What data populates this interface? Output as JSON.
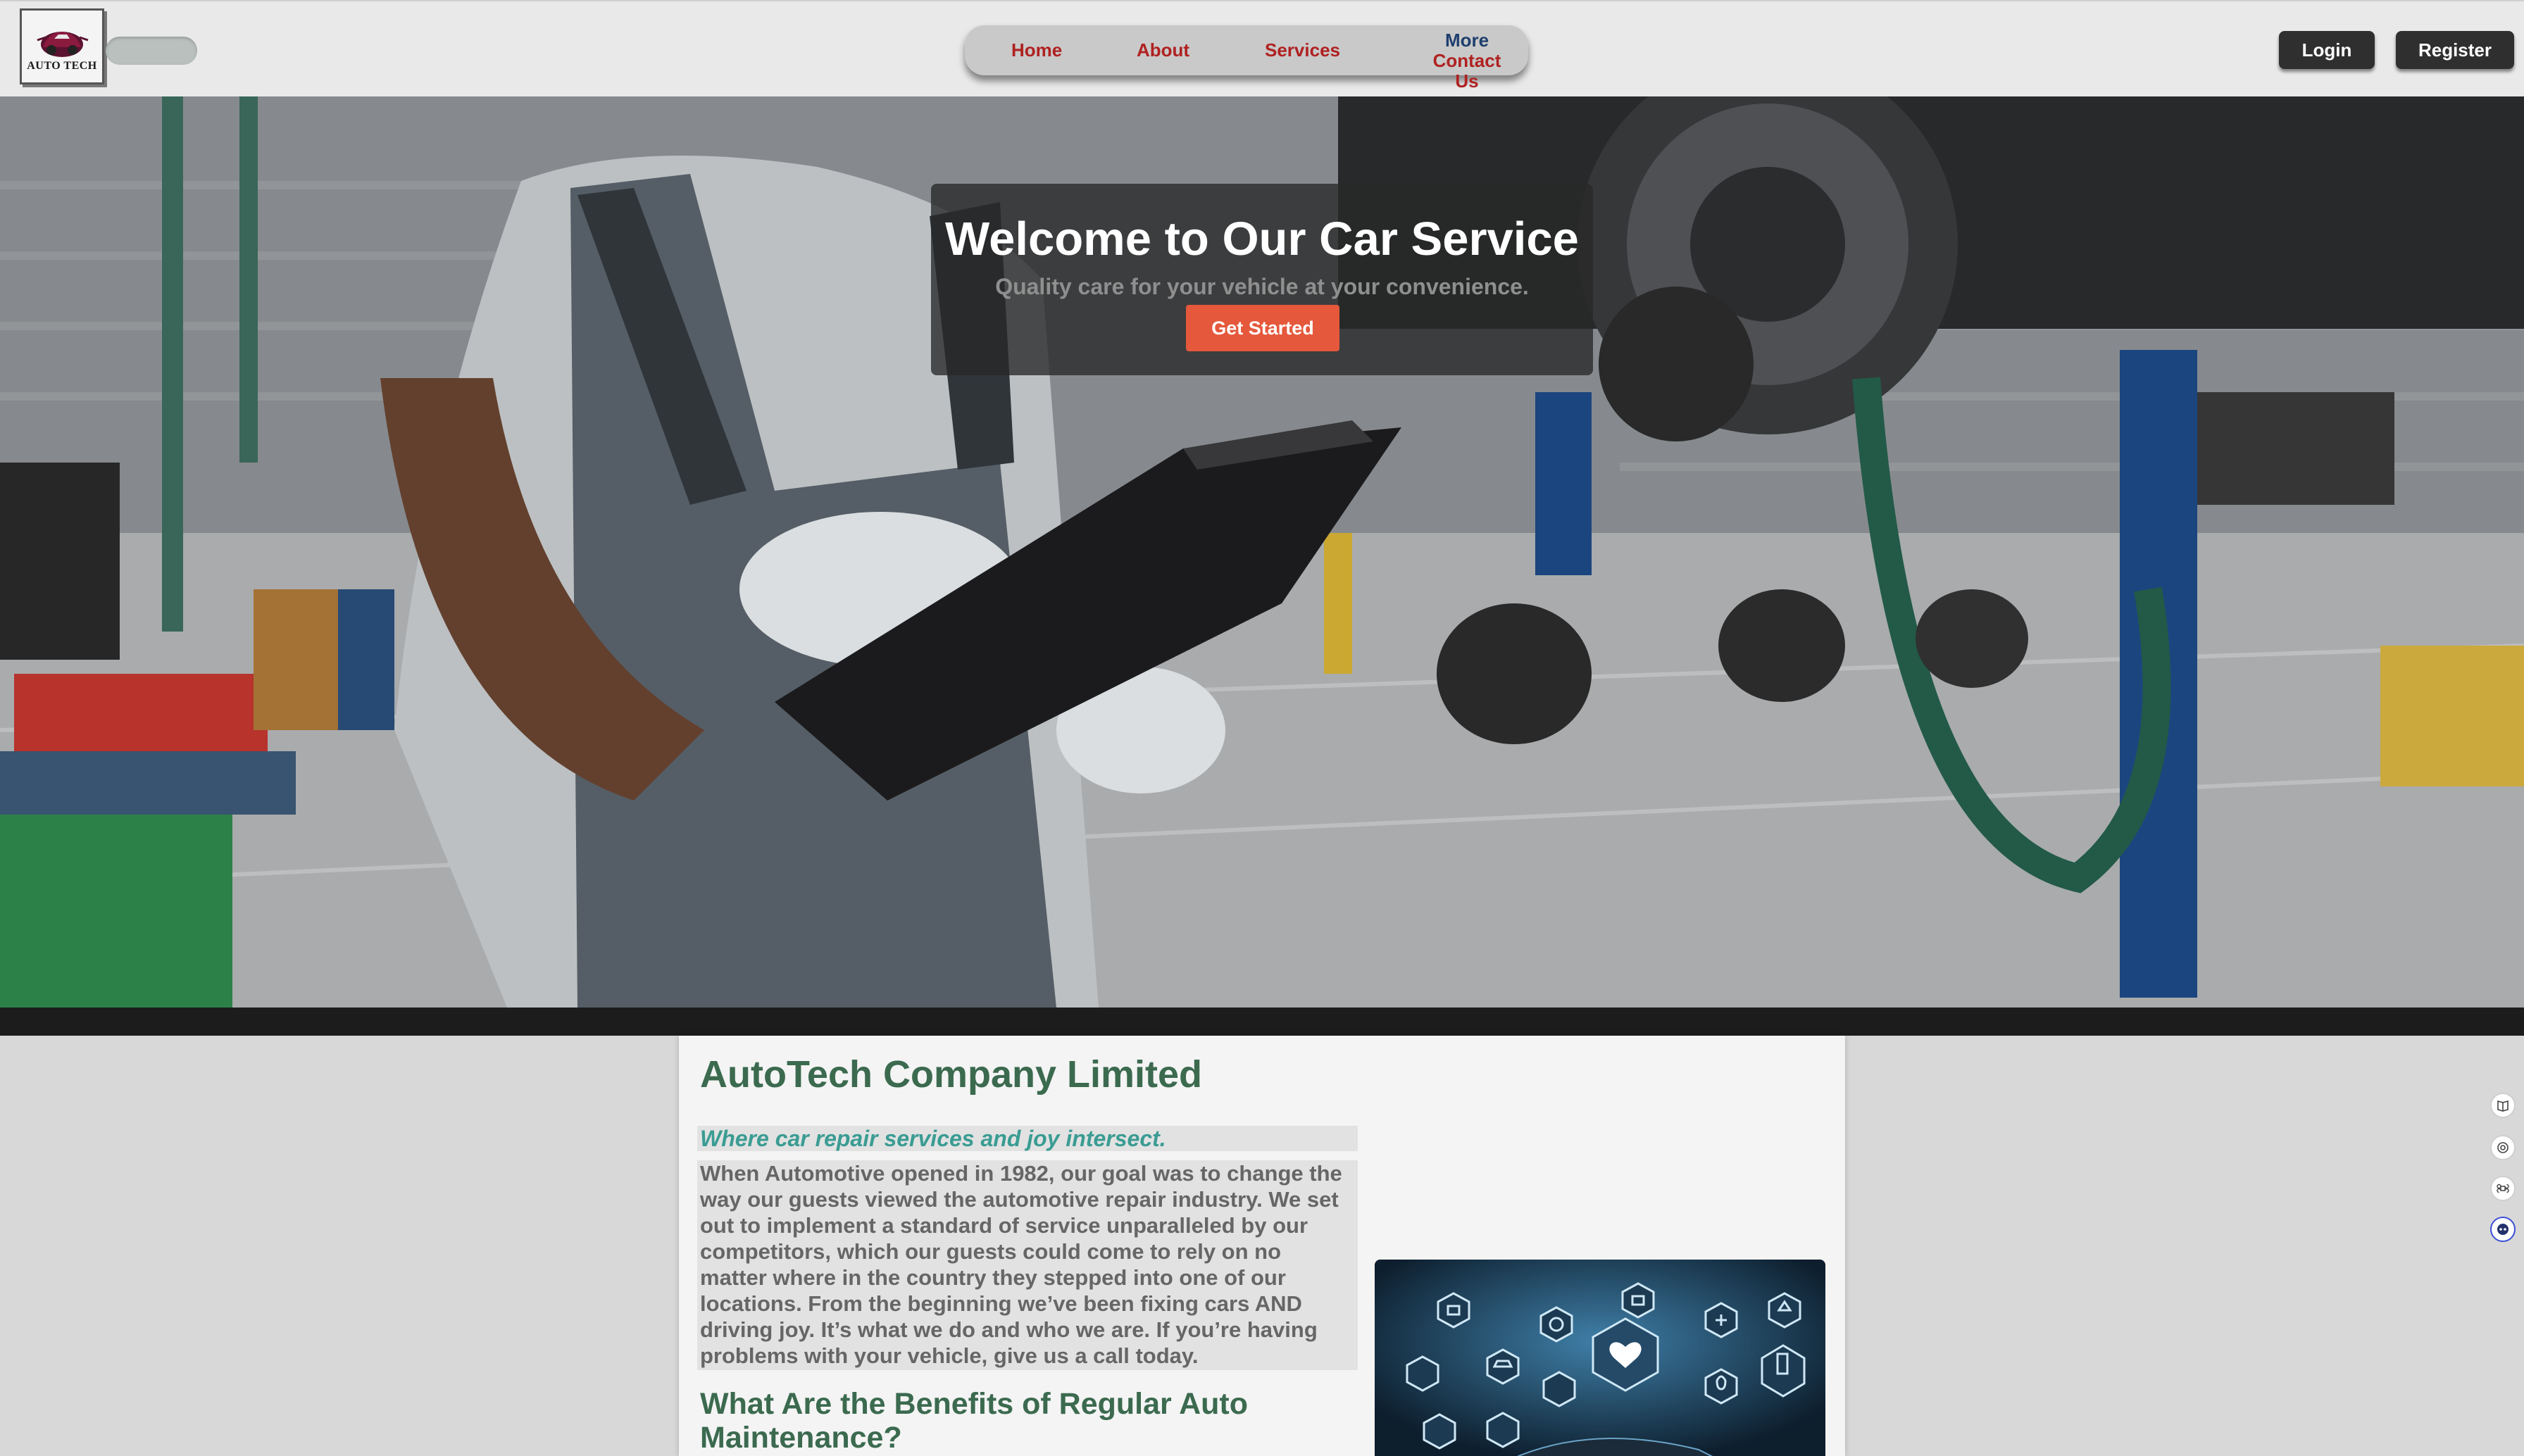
{
  "header": {
    "logo_text": "AUTO TECH",
    "nav": {
      "home": "Home",
      "about": "About",
      "services": "Services",
      "more": "More",
      "contact": "Contact Us"
    },
    "login_label": "Login",
    "register_label": "Register"
  },
  "hero": {
    "title": "Welcome to Our Car Service",
    "subtitle": "Quality care for your vehicle at your convenience.",
    "cta_label": "Get Started"
  },
  "about": {
    "company_title": "AutoTech Company Limited",
    "tagline": "Where car repair services and joy intersect.",
    "body": "When Automotive opened in 1982, our goal was to change the way our guests viewed the automotive repair industry. We set out to implement a standard of service unparalleled by our competitors, which our guests could come to rely on no matter where in the country they stepped into one of our locations. From the beginning we’ve been fixing cars AND driving joy. It’s what we do and who we are. If you’re having problems with your vehicle, give us a call today.",
    "benefits_title": "What Are the Benefits of Regular Auto Maintenance?"
  },
  "rail": {
    "icons": [
      "book-icon",
      "target-icon",
      "command-icon",
      "chatbot-icon"
    ]
  },
  "colors": {
    "nav_link": "#b02121",
    "nav_more": "#1f3f6e",
    "cta": "#e5583c",
    "heading_green": "#3b6a4f",
    "tagline_teal": "#3a9c93",
    "dark_button": "#2f2f2f"
  }
}
